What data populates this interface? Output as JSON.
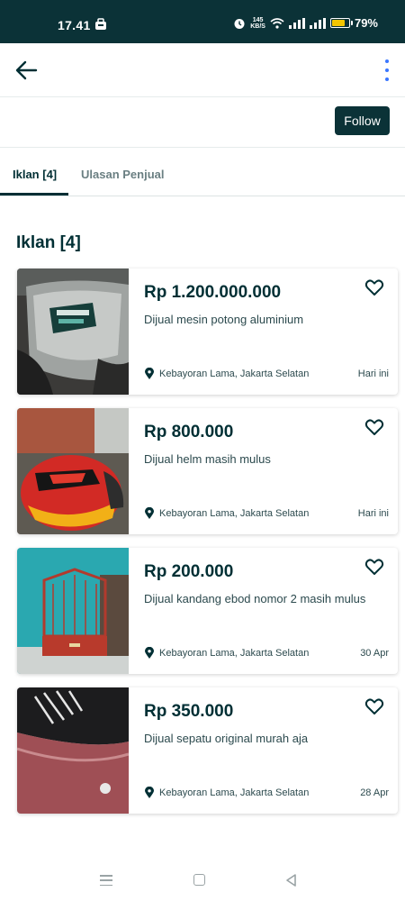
{
  "status_bar": {
    "time": "17.41",
    "net_speed_value": "145",
    "net_speed_unit": "KB/S",
    "battery": "79%",
    "battery_level": 0.79,
    "battery_color": "#f2c500"
  },
  "app_bar": {
    "back_icon": "arrow-left-icon",
    "more_icon": "more-vertical-icon"
  },
  "profile": {
    "follow_label": "Follow"
  },
  "tabs": [
    {
      "label": "Iklan [4]",
      "active": true
    },
    {
      "label": "Ulasan Penjual",
      "active": false
    }
  ],
  "section_title": "Iklan [4]",
  "listings": [
    {
      "price": "Rp 1.200.000.000",
      "title": "Dijual mesin potong aluminium",
      "location": "Kebayoran Lama, Jakarta Selatan",
      "date": "Hari ini"
    },
    {
      "price": "Rp 800.000",
      "title": "Dijual helm masih mulus",
      "location": "Kebayoran Lama, Jakarta Selatan",
      "date": "Hari ini"
    },
    {
      "price": "Rp 200.000",
      "title": "Dijual kandang ebod nomor 2 masih mulus",
      "location": "Kebayoran Lama, Jakarta Selatan",
      "date": "30 Apr"
    },
    {
      "price": "Rp 350.000",
      "title": "Dijual sepatu original murah aja",
      "location": "Kebayoran Lama, Jakarta Selatan",
      "date": "28 Apr"
    }
  ],
  "colors": {
    "primary_dark": "#0b3237",
    "text_primary": "#002f34",
    "more_dots": "#3a77ff"
  }
}
